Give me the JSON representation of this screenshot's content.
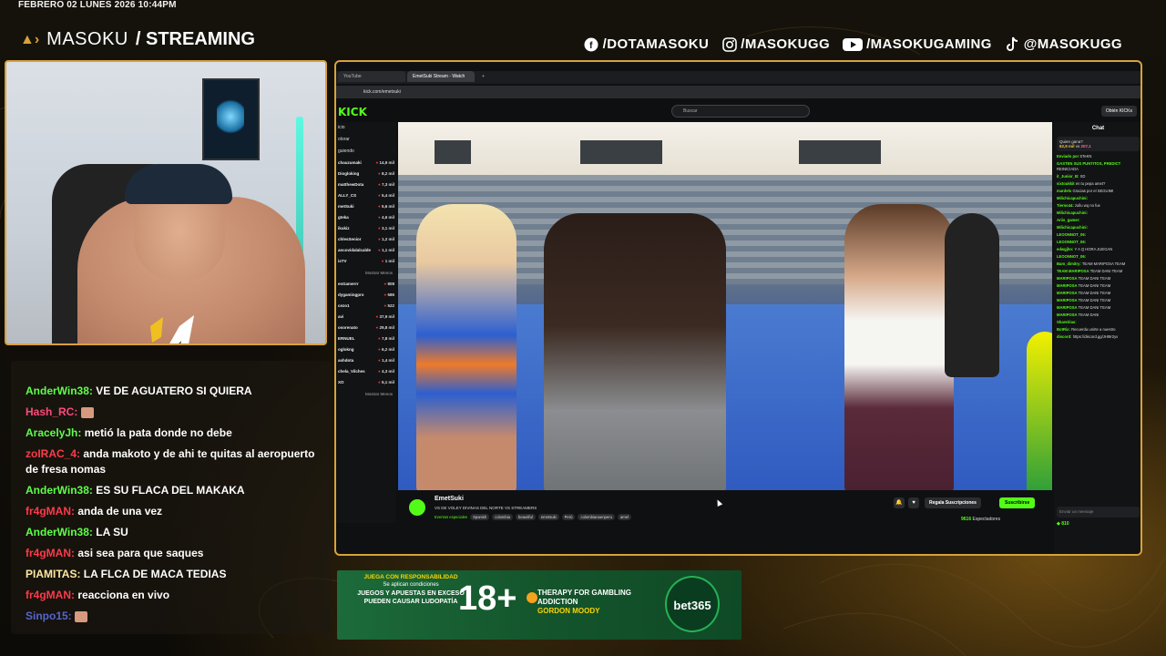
{
  "overlay": {
    "date": "FEBRERO 02 LUNES 2026 10:44PM",
    "brand_main": "MASOKU",
    "brand_sub": "/ STREAMING",
    "socials": [
      {
        "icon": "facebook-icon",
        "label": "/DOTAMASOKU"
      },
      {
        "icon": "instagram-icon",
        "label": "/MASOKUGG"
      },
      {
        "icon": "youtube-icon",
        "label": "/MASOKUGAMING"
      },
      {
        "icon": "tiktok-icon",
        "label": "@MASOKUGG"
      }
    ],
    "accent_color": "#d8a23a"
  },
  "chat": {
    "messages": [
      {
        "user": "AnderWin38:",
        "text": "VE DE AGUATERO SI QUIERA",
        "color": "#5fff4a"
      },
      {
        "user": "Hash_RC:",
        "text": "",
        "color": "#ff4a7a",
        "emote": true
      },
      {
        "user": "AracelyJh:",
        "text": "metió la pata donde no debe",
        "color": "#5fff4a"
      },
      {
        "user": "zoIRAC_4:",
        "text": "anda makoto y de ahi te quitas al aeropuerto de fresa nomas",
        "color": "#ff3a4a"
      },
      {
        "user": "AnderWin38:",
        "text": "ES SU FLACA DEL MAKAKA",
        "color": "#5fff4a"
      },
      {
        "user": "fr4gMAN:",
        "text": "anda de una vez",
        "color": "#ff3a4a"
      },
      {
        "user": "AnderWin38:",
        "text": "LA SU",
        "color": "#5fff4a"
      },
      {
        "user": "fr4gMAN:",
        "text": "asi sea para que saques",
        "color": "#ff3a4a"
      },
      {
        "user": "PIAMITAS:",
        "text": "LA FLCA DE MACA TEDIAS",
        "color": "#ffe8a0"
      },
      {
        "user": "fr4gMAN:",
        "text": "reacciona en vivo",
        "color": "#ff3a4a"
      },
      {
        "user": "Sinpo15:",
        "text": "",
        "color": "#5566cc",
        "emote": true
      }
    ]
  },
  "browser": {
    "tabs": [
      {
        "label": "YouTube"
      },
      {
        "label": "EmetSuki Stream - Watch"
      }
    ],
    "url": "kick.com/emetsuki",
    "search_placeholder": "Buscar",
    "get_kicks": "Obtén KICKs",
    "nav": [
      "icio",
      "olorar",
      "guiendo"
    ],
    "channels": [
      {
        "name": "chauzumaki",
        "viewers": "14,9 mil"
      },
      {
        "name": "Diogloking",
        "viewers": "8,2 mil"
      },
      {
        "name": "matthewDota",
        "viewers": "7,3 mil"
      },
      {
        "name": "ALLY_CS",
        "viewers": "5,4 mil"
      },
      {
        "name": "metSuki",
        "viewers": "5,6 mil"
      },
      {
        "name": "gteka",
        "viewers": "4,6 mil"
      },
      {
        "name": "ikukiz",
        "viewers": "3,1 mil"
      },
      {
        "name": "chlesSenior",
        "viewers": "1,2 mil"
      },
      {
        "name": "ancovidalalcalde",
        "viewers": "1,1 mil"
      },
      {
        "name": "isTV",
        "viewers": "1 mil"
      }
    ],
    "show_less": "Mostrar Menos",
    "channels2": [
      {
        "name": "esGamerrr",
        "viewers": "808"
      },
      {
        "name": "dygamingpro",
        "viewers": "586"
      },
      {
        "name": "cezo1",
        "viewers": "522"
      },
      {
        "name": "avi",
        "viewers": "37,9 mil"
      },
      {
        "name": "osorenato",
        "viewers": "29,8 mil"
      },
      {
        "name": "ERNUEL",
        "viewers": "7,8 mil"
      },
      {
        "name": "oglokng",
        "viewers": "6,2 mil"
      },
      {
        "name": "ashdota",
        "viewers": "1,4 mil"
      },
      {
        "name": "chela_Vilches",
        "viewers": "4,3 mil"
      },
      {
        "name": "XO",
        "viewers": "5,1 mil"
      }
    ],
    "streamer": "EmetSuki",
    "stream_title": "VS DE VOLEY DIVINAS DEL NORTE VS STREAMERS",
    "category": "Eventos especiales",
    "tags": [
      "Spanish",
      "colombia",
      "beautiful",
      "emetsuki",
      "Perú",
      "colombianaenperu",
      "amel"
    ],
    "gift_button": "Regala Suscripciones",
    "sub_button": "Suscribirse",
    "viewers_count": "9616",
    "viewers_label": "Espectadores",
    "chat_title": "Chat",
    "predict_question": "Quien gana?",
    "predict_left": "62,9 mil",
    "predict_vs": "vs",
    "predict_right": "207,1",
    "chat_lines": [
      {
        "u": "Enviado por",
        "t": "STeKN"
      },
      {
        "u": "GASTEN SUS PUNTITOS, PREDICT",
        "t": "REINICIADA"
      },
      {
        "u": "it_Junior_B:",
        "t": "XD"
      },
      {
        "u": "sixtoukkit",
        "t": "en tu pepa amet?"
      },
      {
        "u": "mardelo",
        "t": "Gracias por el SEGUIMI"
      },
      {
        "u": "Milichicapuchini:",
        "t": ""
      },
      {
        "u": "Tierno44:",
        "t": "zullu wq no fue"
      },
      {
        "u": "Milichicapuchini:",
        "t": ""
      },
      {
        "u": "Ariis_gamer:",
        "t": ""
      },
      {
        "u": "Milichicapuchini:",
        "t": ""
      },
      {
        "u": "LEOONNOT_06:",
        "t": ""
      },
      {
        "u": "LEOONNOT_06:",
        "t": ""
      },
      {
        "u": "edwgjhn:",
        "t": "Y A Q HORA JUEGAN"
      },
      {
        "u": "LEOONNOT_06:",
        "t": ""
      },
      {
        "u": "Bam_dimitry:",
        "t": "TEAM MARIPOSA TEAM"
      },
      {
        "u": "TEAM MARIPOSA",
        "t": "TEAM DANI TEAM"
      },
      {
        "u": "MARIPOSA",
        "t": "TEAM DANI TEAM"
      },
      {
        "u": "MARIPOSA",
        "t": "TEAM DANI TEAM"
      },
      {
        "u": "MARIPOSA",
        "t": "TEAM DANI TEAM"
      },
      {
        "u": "MARIPOSA",
        "t": "TEAM DANI TEAM"
      },
      {
        "u": "MARIPOSA",
        "t": "TEAM DANI TEAM"
      },
      {
        "u": "MARIPOSA",
        "t": "TEAM DANI"
      },
      {
        "u": "Sharelrias:",
        "t": ""
      },
      {
        "u": "BotRix:",
        "t": "Recuerda unirte a nuestro"
      },
      {
        "u": "discord:",
        "t": "https://discord.gg/JHt9r2yv"
      }
    ],
    "chat_input_placeholder": "Enviar un mensaje",
    "points": "810"
  },
  "ad": {
    "line1": "JUEGA CON RESPONSABILIDAD",
    "line2": "Se aplican condiciones",
    "line3": "JUEGOS Y APUESTAS EN EXCESO PUEDEN CAUSAR LUDOPATÍA",
    "age": "18+",
    "therapy": "THERAPY FOR GAMBLING ADDICTION",
    "gordon": "GORDON MOODY",
    "bet_logo": "bet365"
  }
}
